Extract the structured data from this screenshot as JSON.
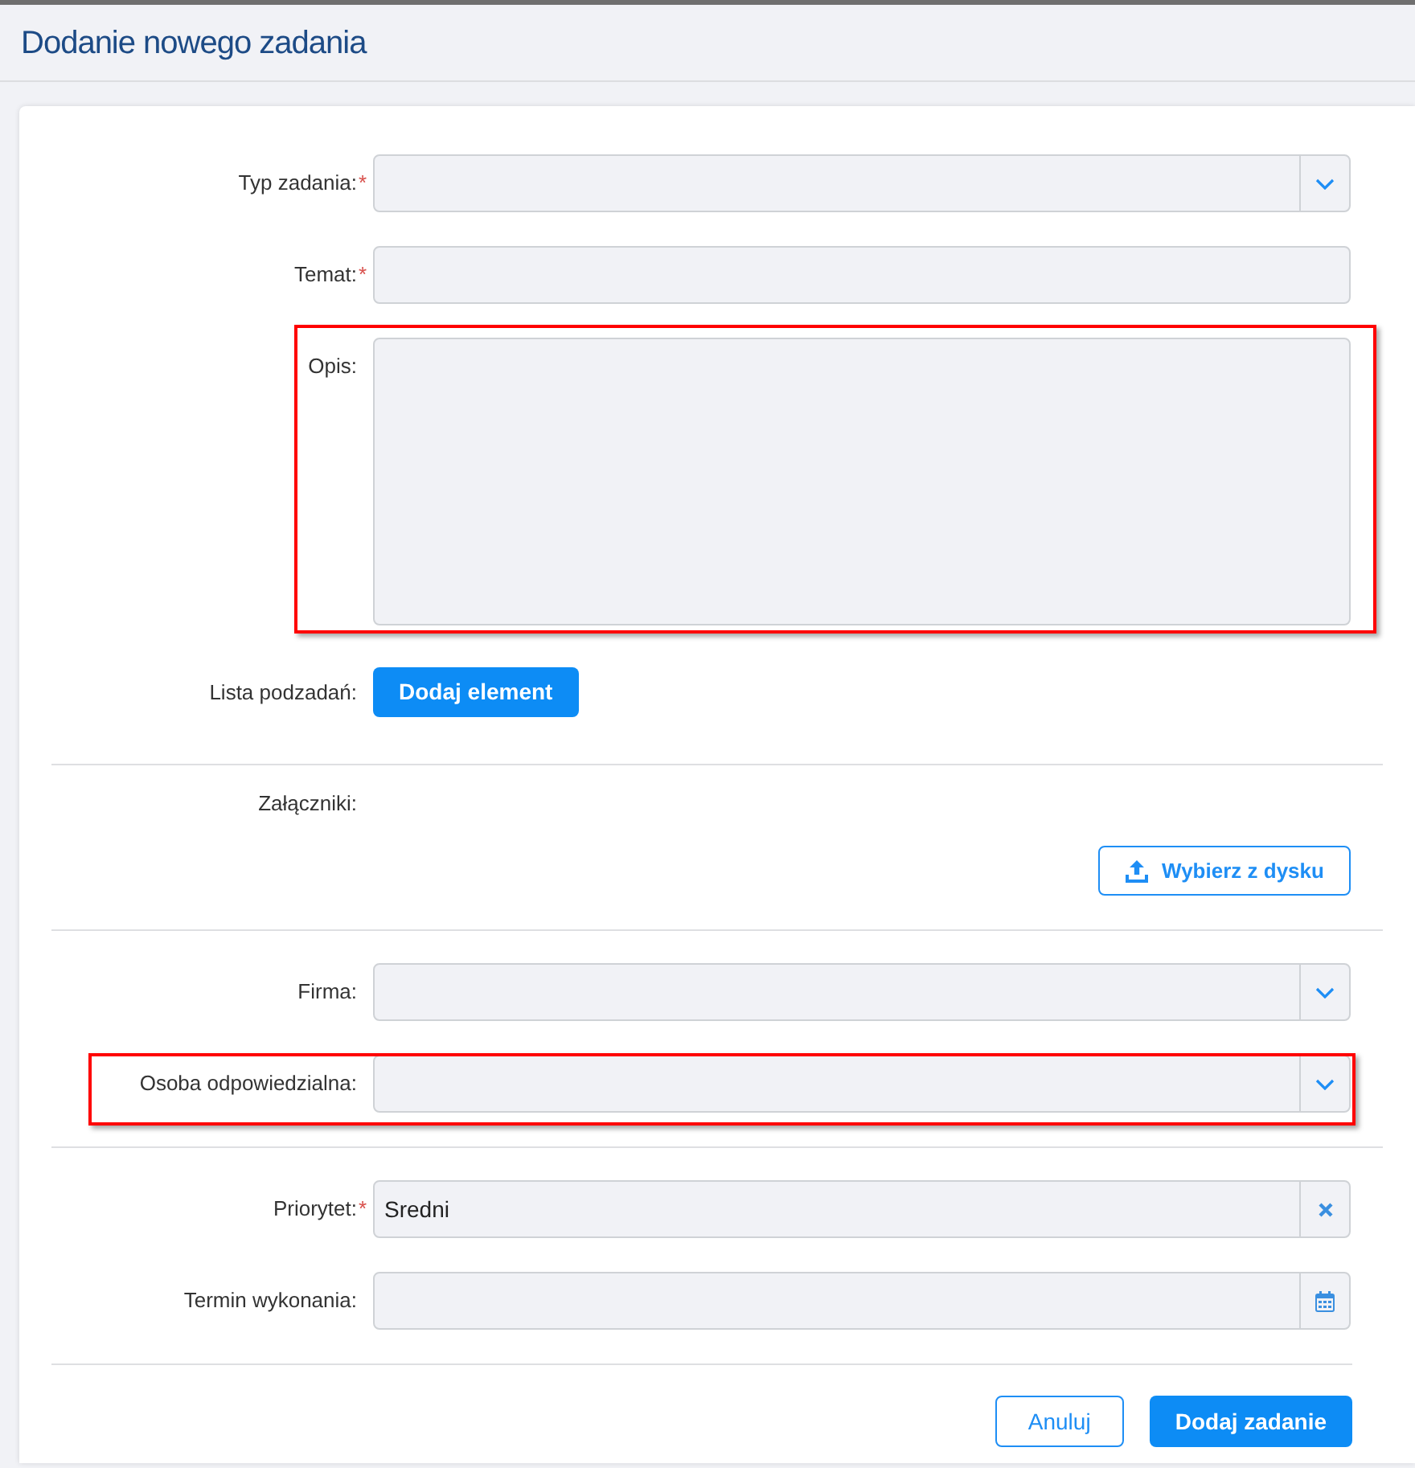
{
  "header": {
    "title": "Dodanie nowego zadania"
  },
  "form": {
    "sections": [
      {
        "rows": [
          {
            "kind": "select",
            "label": "Typ zadania:",
            "required_mark": "*",
            "highlighted": false
          },
          {
            "kind": "text",
            "label": "Temat:",
            "required_mark": "*",
            "highlighted": false
          },
          {
            "kind": "textarea",
            "label": "Opis:",
            "highlighted": true
          },
          {
            "kind": "button",
            "label": "Lista podzadań:",
            "button": "Dodaj element",
            "highlighted": false
          }
        ]
      },
      {
        "rows": [
          {
            "kind": "upload",
            "label": "Załączniki:",
            "button": "Wybierz z dysku",
            "highlighted": false
          }
        ]
      },
      {
        "rows": [
          {
            "kind": "select",
            "label": "Firma:",
            "highlighted": false
          },
          {
            "kind": "select",
            "label": "Osoba odpowiedzialna:",
            "highlighted": true
          }
        ]
      },
      {
        "rows": [
          {
            "kind": "clearable",
            "label": "Priorytet:",
            "required_mark": "*",
            "value": "Sredni",
            "highlighted": false
          },
          {
            "kind": "date",
            "label": "Termin wykonania:",
            "highlighted": false
          }
        ]
      }
    ],
    "actions": [
      {
        "label": "Anuluj",
        "kind": "secondary"
      },
      {
        "label": "Dodaj zadanie",
        "kind": "primary"
      }
    ]
  }
}
